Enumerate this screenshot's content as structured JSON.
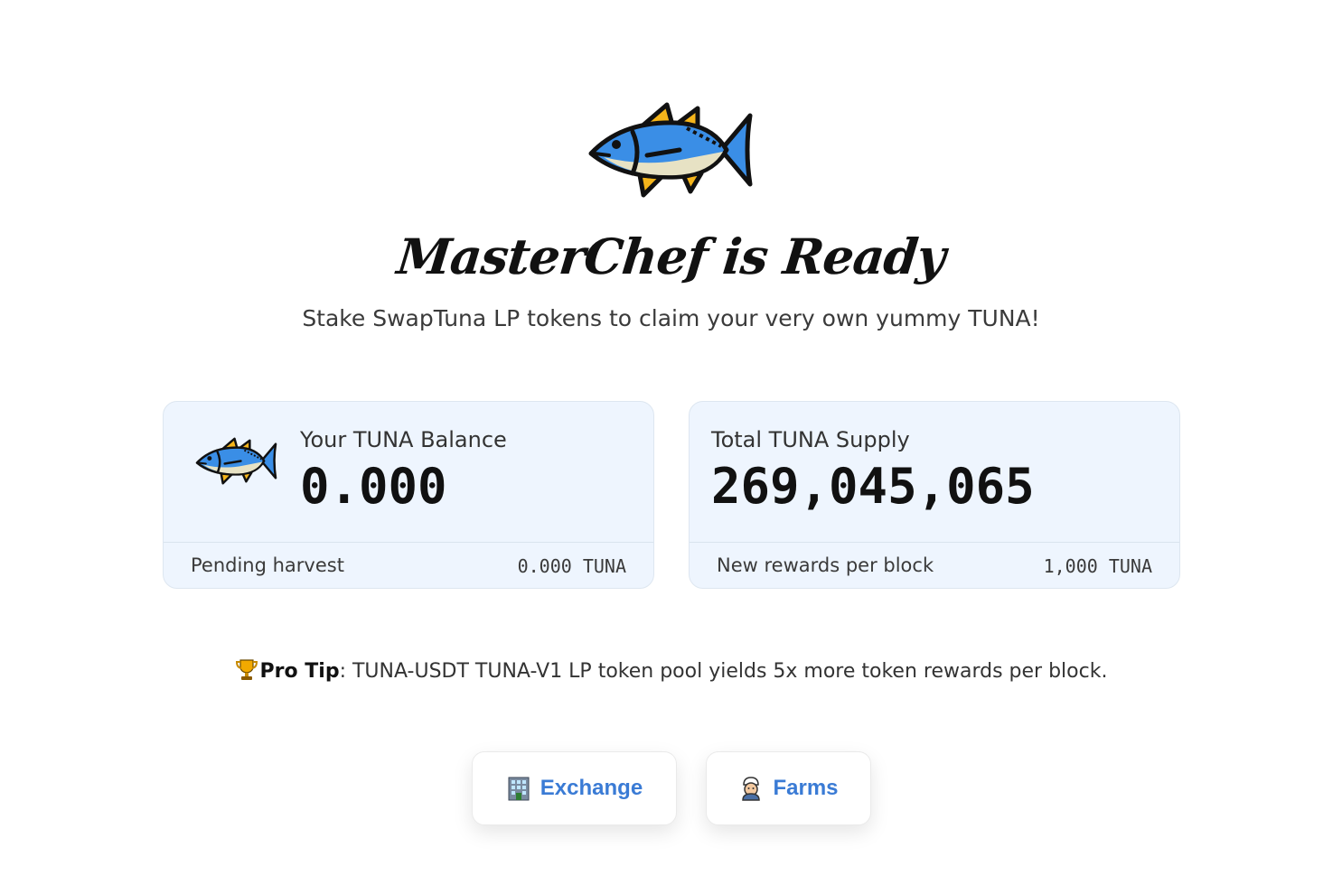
{
  "hero": {
    "title": "MasterChef is Ready",
    "subtitle": "Stake SwapTuna LP tokens to claim your very own yummy TUNA!"
  },
  "balance_card": {
    "label": "Your TUNA Balance",
    "value": "0.000",
    "footer_label": "Pending harvest",
    "footer_value": "0.000 TUNA"
  },
  "supply_card": {
    "label": "Total TUNA Supply",
    "value": "269,045,065",
    "footer_label": "New rewards per block",
    "footer_value": "1,000 TUNA"
  },
  "pro_tip": {
    "heading": "Pro Tip",
    "text": ": TUNA-USDT TUNA-V1 LP token pool yields 5x more token rewards per block."
  },
  "nav": {
    "exchange_label": "Exchange",
    "farms_label": "Farms"
  },
  "colors": {
    "card_bg": "#eef5fe",
    "link_blue": "#3a7bd5",
    "fish_blue": "#3a8ee6",
    "fish_fin": "#f5b51b"
  },
  "icons": {
    "hero": "tuna-fish-icon",
    "card": "tuna-fish-icon",
    "protip": "trophy-icon",
    "exchange": "office-building-icon",
    "farms": "cook-icon"
  }
}
